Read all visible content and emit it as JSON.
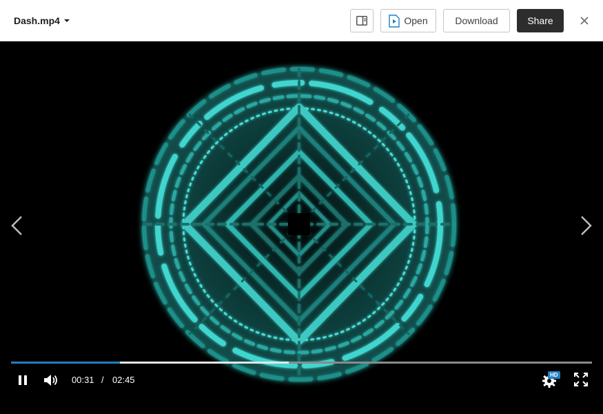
{
  "header": {
    "file_name": "Dash.mp4",
    "open_label": "Open",
    "download_label": "Download",
    "share_label": "Share"
  },
  "player": {
    "current_time": "00:31",
    "separator": "/",
    "total_time": "02:45",
    "progress_fraction": 0.188,
    "buffered_fraction": 0.478,
    "quality_badge": "HD"
  },
  "icons": {
    "panel": "side-panel-icon",
    "open": "play-file-icon",
    "close": "close-icon",
    "prev": "chevron-left-icon",
    "next": "chevron-right-icon",
    "pause": "pause-icon",
    "volume": "volume-icon",
    "settings": "gear-icon",
    "fullscreen": "fullscreen-icon"
  },
  "colors": {
    "accent": "#1f7fc3",
    "video_glow": "#3fd6cf",
    "share_bg": "#2d2d2d"
  }
}
